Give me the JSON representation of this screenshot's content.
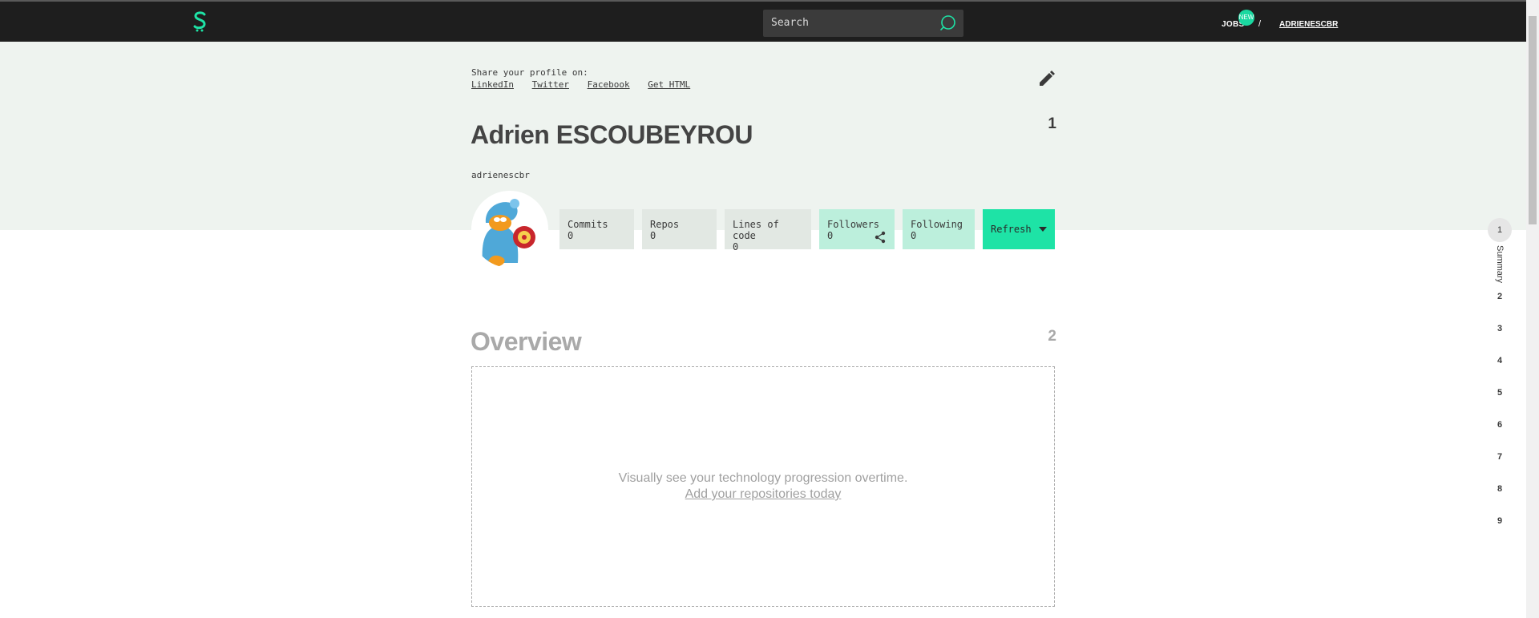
{
  "topbar": {
    "logo_icon": "s-logo-icon",
    "search_placeholder": "Search",
    "search_icon": "search-icon",
    "jobs_label": "JOBS",
    "new_badge": "NEW",
    "separator": "/",
    "username": "ADRIENESCBR"
  },
  "share": {
    "label": "Share your profile on:",
    "links": [
      "LinkedIn",
      "Twitter",
      "Facebook",
      "Get HTML"
    ]
  },
  "profile": {
    "name": "Adrien ESCOUBEYROU",
    "handle": "adrienescbr",
    "section_number": "1",
    "edit_icon": "pencil-icon",
    "avatar_icon": "garfield-avatar"
  },
  "stats": [
    {
      "label": "Commits",
      "value": "0"
    },
    {
      "label": "Repos",
      "value": "0"
    },
    {
      "label": "Lines of code",
      "value": "0"
    },
    {
      "label": "Followers",
      "value": "0"
    },
    {
      "label": "Following",
      "value": "0"
    }
  ],
  "refresh": {
    "label": "Refresh"
  },
  "overview": {
    "title": "Overview",
    "section_number": "2",
    "message": "Visually see your technology progression overtime.",
    "link": "Add your repositories today"
  },
  "side_nav": {
    "active_number": "1",
    "active_label": "Summary",
    "numbers": [
      "2",
      "3",
      "4",
      "5",
      "6",
      "7",
      "8",
      "9"
    ]
  },
  "colors": {
    "topbar": "#1e1e1e",
    "accent": "#1ee3a6",
    "header_band": "#eef3ef"
  }
}
